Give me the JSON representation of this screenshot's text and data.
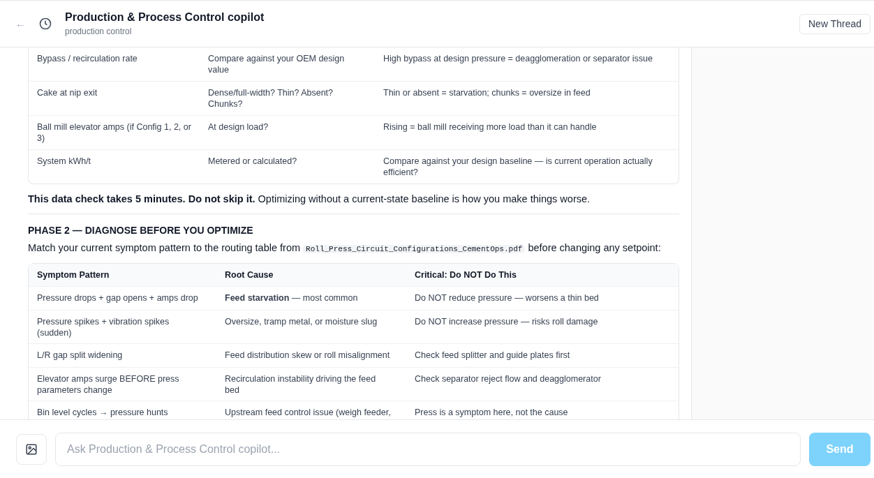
{
  "header": {
    "back": "←",
    "title": "Production & Process Control copilot",
    "subtitle": "production control",
    "new_thread": "New Thread"
  },
  "table_1": {
    "rows": [
      {
        "cells": [
          "Bypass / recirculation rate",
          "Compare against your OEM design value",
          "High bypass at design pressure = deagglomeration or separator issue"
        ]
      },
      {
        "cells": [
          "Cake at nip exit",
          "Dense/full-width? Thin? Absent? Chunks?",
          "Thin or absent = starvation; chunks = oversize in feed"
        ]
      },
      {
        "cells": [
          "Ball mill elevator amps (if Config 1, 2, or 3)",
          "At design load?",
          "Rising = ball mill receiving more load than it can handle"
        ]
      },
      {
        "cells": [
          "System kWh/t",
          "Metered or calculated?",
          "Compare against your design baseline — is current operation actually efficient?"
        ]
      }
    ]
  },
  "note": "**This data check takes 5 minutes. Do not skip it.** Optimizing without a current-state baseline is how you make things worse.",
  "phase_heading": "PHASE 2 — DIAGNOSE BEFORE YOU OPTIMIZE",
  "intro": {
    "before": "Match your current symptom pattern to the routing table from",
    "file": "Roll_Press_Circuit_Configurations_CementOps.pdf",
    "after": "before changing any setpoint:"
  },
  "table_2": {
    "columns": [
      "Symptom Pattern",
      "Root Cause",
      "Critical: Do NOT Do This"
    ],
    "rows": [
      {
        "cells": [
          "Pressure drops + gap opens + amps drop",
          "**Feed starvation** — most common",
          "Do NOT reduce pressure — worsens a thin bed"
        ]
      },
      {
        "cells": [
          "Pressure spikes + vibration spikes (sudden)",
          "Oversize, tramp metal, or moisture slug",
          "Do NOT increase pressure — risks roll damage"
        ]
      },
      {
        "cells": [
          "L/R gap split widening",
          "Feed distribution skew or roll misalignment",
          "Check feed splitter and guide plates first"
        ]
      },
      {
        "cells": [
          "Elevator amps surge BEFORE press parameters change",
          "Recirculation instability driving the feed bed",
          "Check separator reject flow and deagglomerator"
        ]
      },
      {
        "cells": [
          "Bin level cycles → pressure hunts",
          "Upstream feed control issue (weigh feeder,",
          "Press is a symptom here, not the cause"
        ]
      }
    ]
  },
  "composer": {
    "placeholder": "Ask Production & Process Control copilot...",
    "send": "Send",
    "send_disabled": true
  }
}
